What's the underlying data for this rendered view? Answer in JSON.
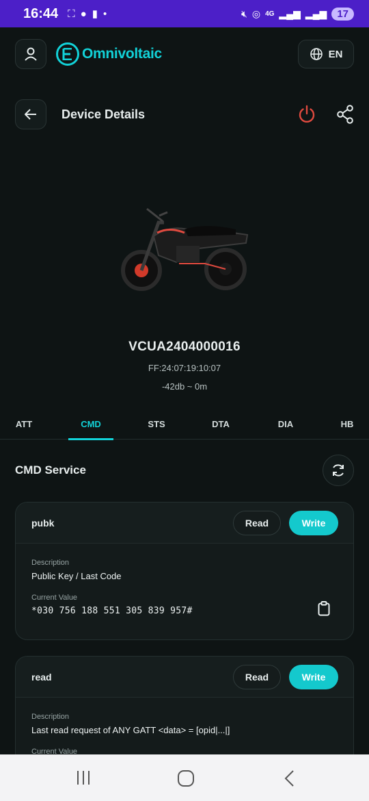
{
  "status": {
    "time": "16:44",
    "network": "4G",
    "battery": "17"
  },
  "app": {
    "brand": "Omnivoltaic",
    "language": "EN"
  },
  "header": {
    "title": "Device Details"
  },
  "device": {
    "name": "VCUA2404000016",
    "mac": "FF:24:07:19:10:07",
    "rssi": "-42db ~ 0m"
  },
  "tabs": [
    {
      "label": "ATT"
    },
    {
      "label": "CMD",
      "active": true
    },
    {
      "label": "STS"
    },
    {
      "label": "DTA"
    },
    {
      "label": "DIA"
    },
    {
      "label": "HB"
    }
  ],
  "section": {
    "title": "CMD Service"
  },
  "cards": [
    {
      "name": "pubk",
      "read_label": "Read",
      "write_label": "Write",
      "description_label": "Description",
      "description": "Public Key / Last Code",
      "current_label": "Current Value",
      "current_value": "*030 756 188 551 305 839 957#"
    },
    {
      "name": "read",
      "read_label": "Read",
      "write_label": "Write",
      "description_label": "Description",
      "description": "Last read request of ANY GATT <data> = [opid|...|]",
      "current_label": "Current Value"
    }
  ],
  "colors": {
    "accent": "#12d2d8",
    "danger": "#e04a3f",
    "statusbar": "#4c1fc8",
    "background": "#0e1414"
  }
}
